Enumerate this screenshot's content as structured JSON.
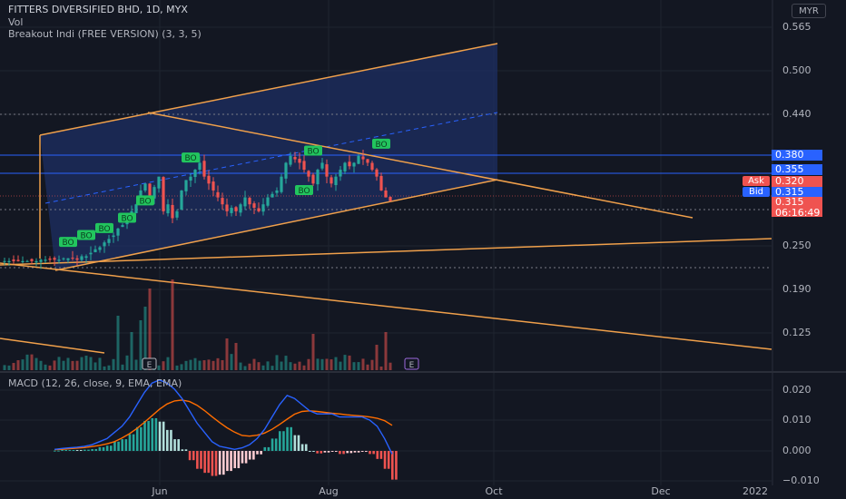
{
  "header": {
    "symbol_line": "FITTERS DIVERSIFIED BHD, 1D, MYX",
    "volume_label": "Vol",
    "indicator_label": "Breakout Indi (FREE VERSION) (3, 3, 5)",
    "currency": "MYR"
  },
  "macd_panel": {
    "label": "MACD (12, 26, close, 9, EMA, EMA)"
  },
  "price_axis": {
    "ticks": [
      "0.565",
      "0.500",
      "0.440",
      "0.380",
      "0.355",
      "0.320",
      "0.315",
      "0.315",
      "0.250",
      "0.190",
      "0.125"
    ]
  },
  "macd_axis": {
    "ticks": [
      "0.020",
      "0.010",
      "0.000",
      "−0.010"
    ]
  },
  "time_axis": {
    "labels": [
      "Jun",
      "Aug",
      "Oct",
      "Dec",
      "2022"
    ]
  },
  "price_tags": {
    "level_380": "0.380",
    "level_355": "0.355",
    "ask_label": "Ask",
    "ask_value": "0.320",
    "bid_label": "Bid",
    "bid_value": "0.315",
    "last_price": "0.315",
    "countdown": "06:16:49"
  },
  "signals": {
    "bo_label": "BO",
    "earnings_label": "E"
  },
  "colors": {
    "background": "#131722",
    "bull": "#26a69a",
    "bear": "#ef5350",
    "trendline": "#f0a04b",
    "channel_fill": "#1e2f63",
    "horizontal_level": "#2962ff",
    "macd_line": "#2962ff",
    "signal_line": "#ff6d00",
    "bo_badge": "#22c55e"
  },
  "chart_data": {
    "type": "candlestick",
    "price_range": [
      0.1,
      0.58
    ],
    "horizontal_levels": [
      0.38,
      0.355,
      0.315
    ],
    "price_series": [
      0.228,
      0.228,
      0.228,
      0.228,
      0.228,
      0.228,
      0.228,
      0.228,
      0.23,
      0.23,
      0.23,
      0.23,
      0.23,
      0.232,
      0.232,
      0.232,
      0.23,
      0.235,
      0.235,
      0.24,
      0.245,
      0.248,
      0.255,
      0.26,
      0.265,
      0.275,
      0.28,
      0.29,
      0.3,
      0.31,
      0.33,
      0.34,
      0.32,
      0.335,
      0.35,
      0.3,
      0.31,
      0.29,
      0.3,
      0.33,
      0.345,
      0.35,
      0.36,
      0.37,
      0.35,
      0.34,
      0.33,
      0.32,
      0.31,
      0.3,
      0.305,
      0.3,
      0.31,
      0.32,
      0.31,
      0.305,
      0.3,
      0.31,
      0.32,
      0.325,
      0.33,
      0.35,
      0.37,
      0.38,
      0.375,
      0.37,
      0.36,
      0.35,
      0.34,
      0.36,
      0.37,
      0.35,
      0.34,
      0.35,
      0.36,
      0.37,
      0.365,
      0.37,
      0.38,
      0.375,
      0.37,
      0.36,
      0.35,
      0.33,
      0.32,
      0.315
    ],
    "macd_range": [
      -0.012,
      0.025
    ],
    "macd_series": [
      0.0005,
      0.0008,
      0.001,
      0.0012,
      0.0015,
      0.002,
      0.003,
      0.004,
      0.006,
      0.008,
      0.011,
      0.015,
      0.019,
      0.022,
      0.023,
      0.022,
      0.02,
      0.017,
      0.013,
      0.009,
      0.006,
      0.003,
      0.0015,
      0.001,
      0.0005,
      0.001,
      0.002,
      0.004,
      0.007,
      0.011,
      0.015,
      0.018,
      0.017,
      0.015,
      0.013,
      0.012,
      0.012,
      0.012,
      0.011,
      0.011,
      0.011,
      0.011,
      0.01,
      0.008,
      0.004,
      -0.001
    ],
    "signal_series": [
      0.0004,
      0.0005,
      0.0007,
      0.0009,
      0.0011,
      0.0014,
      0.0018,
      0.0023,
      0.003,
      0.0042,
      0.0056,
      0.0073,
      0.0093,
      0.0114,
      0.0135,
      0.0152,
      0.0162,
      0.0165,
      0.016,
      0.0148,
      0.0131,
      0.0111,
      0.0092,
      0.0075,
      0.0061,
      0.005,
      0.0048,
      0.0051,
      0.0058,
      0.007,
      0.0086,
      0.0103,
      0.0119,
      0.0128,
      0.013,
      0.0128,
      0.0125,
      0.0122,
      0.012,
      0.0117,
      0.0115,
      0.0113,
      0.011,
      0.0106,
      0.0098,
      0.0083
    ]
  }
}
